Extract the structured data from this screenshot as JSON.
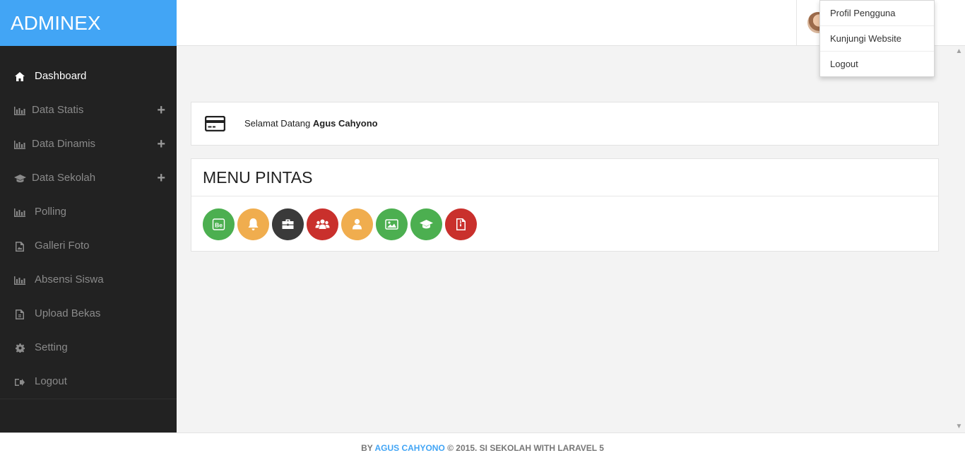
{
  "brand": {
    "title": "ADMINEX"
  },
  "sidebar": {
    "items": [
      {
        "label": "Dashboard",
        "icon": "home-icon",
        "expandable": false,
        "active": true
      },
      {
        "label": "Data Statis",
        "icon": "bar-chart-icon",
        "expandable": true
      },
      {
        "label": "Data Dinamis",
        "icon": "bar-chart-icon",
        "expandable": true
      },
      {
        "label": "Data Sekolah",
        "icon": "graduation-cap-icon",
        "expandable": true
      },
      {
        "label": "Polling",
        "icon": "bar-chart-icon",
        "expandable": false
      },
      {
        "label": "Galleri Foto",
        "icon": "picture-file-icon",
        "expandable": false
      },
      {
        "label": "Absensi Siswa",
        "icon": "bar-chart-icon",
        "expandable": false
      },
      {
        "label": "Upload Bekas",
        "icon": "file-icon",
        "expandable": false
      },
      {
        "label": "Setting",
        "icon": "gear-icon",
        "expandable": false
      },
      {
        "label": "Logout",
        "icon": "sign-out-icon",
        "expandable": false
      }
    ],
    "expand_glyph": "+"
  },
  "user_menu": {
    "items": [
      {
        "label": "Profil Pengguna"
      },
      {
        "label": "Kunjungi Website"
      },
      {
        "label": "Logout"
      }
    ]
  },
  "welcome": {
    "greeting": "Selamat Datang",
    "user_name": "Agus Cahyono"
  },
  "shortcuts": {
    "title": "MENU PINTAS",
    "buttons": [
      {
        "icon": "behance-icon",
        "color": "#4caf50",
        "glyph": "Be"
      },
      {
        "icon": "bell-icon",
        "color": "#f0ad4e"
      },
      {
        "icon": "briefcase-icon",
        "color": "#3a3a3a"
      },
      {
        "icon": "users-icon",
        "color": "#c9302c"
      },
      {
        "icon": "user-icon",
        "color": "#f0ad4e"
      },
      {
        "icon": "image-icon",
        "color": "#4caf50"
      },
      {
        "icon": "graduation-cap-icon",
        "color": "#4caf50"
      },
      {
        "icon": "file-archive-icon",
        "color": "#c9302c"
      }
    ]
  },
  "footer": {
    "prefix": "BY",
    "author": "AGUS CAHYONO",
    "suffix": "© 2015. SI SEKOLAH WITH LARAVEL 5"
  },
  "colors": {
    "brand": "#42a5f5",
    "sidebar": "#222222",
    "background": "#f3f3f3"
  }
}
